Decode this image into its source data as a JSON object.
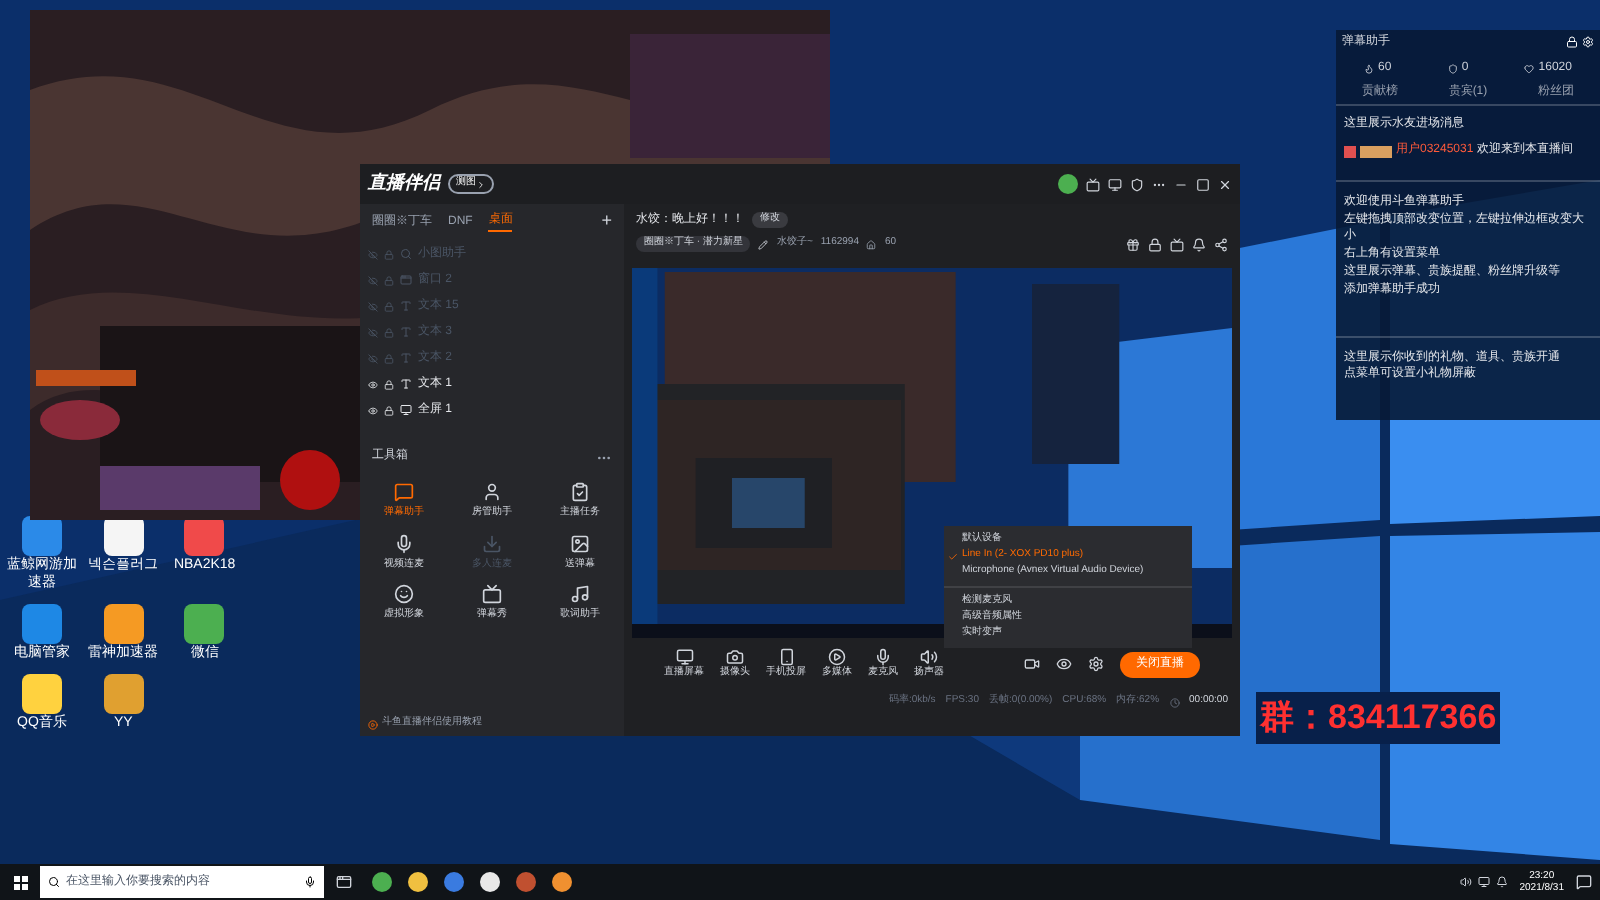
{
  "desktop_icons": [
    {
      "label": "蓝鲸网游加速器"
    },
    {
      "label": "넥슨플러그"
    },
    {
      "label": "NBA2K18"
    },
    {
      "label": "电脑管家"
    },
    {
      "label": "雷神加速器"
    },
    {
      "label": "微信"
    },
    {
      "label": "QQ音乐"
    },
    {
      "label": "YY"
    }
  ],
  "overlay_text": "群：834117366",
  "app": {
    "logo": "直播伴侣",
    "badge": "测图",
    "tabs": [
      {
        "label": "圈圈※丁车",
        "selected": false
      },
      {
        "label": "DNF",
        "selected": false
      },
      {
        "label": "桌面",
        "selected": true
      }
    ],
    "add": "+",
    "sources": [
      {
        "name": "小图助手",
        "visible": false
      },
      {
        "name": "窗口 2",
        "visible": false
      },
      {
        "name": "文本 15",
        "visible": false
      },
      {
        "name": "文本 3",
        "visible": false
      },
      {
        "name": "文本 2",
        "visible": false
      },
      {
        "name": "文本 1",
        "visible": true
      },
      {
        "name": "全屏 1",
        "visible": true
      }
    ],
    "toolbox_title": "工具箱",
    "tools": [
      {
        "label": "弹幕助手",
        "active": true,
        "disabled": false
      },
      {
        "label": "房管助手",
        "active": false,
        "disabled": false
      },
      {
        "label": "主播任务",
        "active": false,
        "disabled": false
      },
      {
        "label": "视频连麦",
        "active": false,
        "disabled": false
      },
      {
        "label": "多人连麦",
        "active": false,
        "disabled": true
      },
      {
        "label": "送弹幕",
        "active": false,
        "disabled": false
      },
      {
        "label": "虚拟形象",
        "active": false,
        "disabled": false
      },
      {
        "label": "弹幕秀",
        "active": false,
        "disabled": false
      },
      {
        "label": "歌词助手",
        "active": false,
        "disabled": false
      }
    ],
    "tutorial": "斗鱼直播伴侣使用教程",
    "announcement": "水饺：晚上好！！！",
    "edit_button": "修改",
    "room_title": "圈圈※丁车 · 潜力新星",
    "streamer": "水饺子~",
    "room_id": "1162994",
    "viewers": "60",
    "controls": [
      {
        "label": "直播屏幕"
      },
      {
        "label": "摄像头"
      },
      {
        "label": "手机投屏"
      },
      {
        "label": "多媒体"
      },
      {
        "label": "麦克风"
      },
      {
        "label": "扬声器"
      }
    ],
    "stop_button": "关闭直播",
    "status": [
      "码率:0kb/s",
      "FPS:30",
      "丢帧:0(0.00%)",
      "CPU:68%",
      "内存:62%"
    ],
    "timer": "00:00:00",
    "mic_menu": [
      {
        "kind": "item",
        "label": "默认设备",
        "checked": false
      },
      {
        "kind": "item",
        "label": "Line In (2- XOX PD10 plus)",
        "checked": true
      },
      {
        "kind": "item",
        "label": "Microphone (Avnex Virtual Audio Device)",
        "checked": false
      },
      {
        "kind": "separator"
      },
      {
        "kind": "item",
        "label": "检测麦克风",
        "checked": false
      },
      {
        "kind": "item",
        "label": "高级音频属性",
        "checked": false
      },
      {
        "kind": "item",
        "label": "实时变声",
        "checked": false
      }
    ]
  },
  "danmu": {
    "title": "弹幕助手",
    "stats": [
      "60",
      "0",
      "16020"
    ],
    "tabs": [
      {
        "label": "贡献榜",
        "selected": false
      },
      {
        "label": "贵宾(1)",
        "selected": false
      },
      {
        "label": "粉丝团",
        "selected": false
      }
    ],
    "enter_hint": "这里展示水友进场消息",
    "user": "用户03245031",
    "welcome": "欢迎来到本直播间",
    "system_lines": [
      "欢迎使用斗鱼弹幕助手",
      "左键拖拽顶部改变位置，左键拉伸边框改变大小",
      "右上角有设置菜单",
      "这里展示弹幕、贵族提醒、粉丝牌升级等",
      "添加弹幕助手成功"
    ],
    "gift_lines": [
      "这里展示你收到的礼物、道具、贵族开通",
      "点菜单可设置小礼物屏蔽"
    ]
  },
  "taskbar": {
    "search_placeholder": "在这里输入你要搜索的内容",
    "time": "23:20",
    "date": "2021/8/31"
  }
}
